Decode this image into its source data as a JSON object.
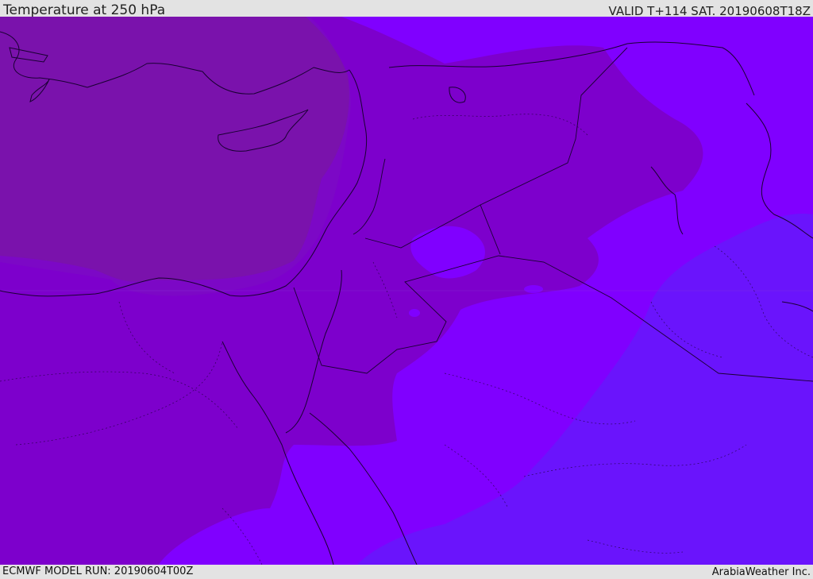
{
  "header": {
    "title": "Temperature at 250 hPa",
    "valid": "VALID T+114 SAT. 20190608T18Z"
  },
  "footer": {
    "model_run": "ECMWF MODEL RUN: 20190604T00Z",
    "credit": "ArabiaWeather Inc."
  },
  "map": {
    "variable": "temperature",
    "pressure_level": "250 hPa",
    "colors": {
      "coldest": "#7a12ac",
      "cold": "#7d00cc",
      "mid": "#8000ff",
      "warm": "#6a14fc",
      "coastline": "#1a0033"
    }
  }
}
